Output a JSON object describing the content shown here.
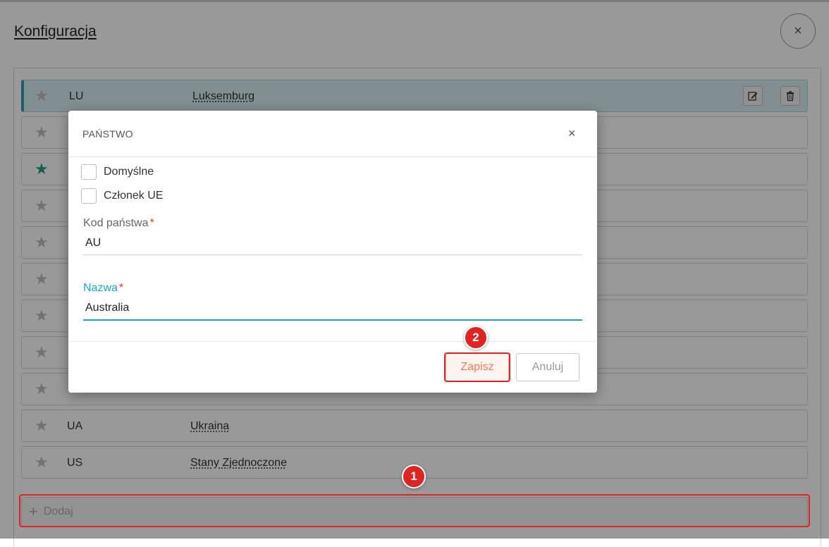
{
  "page": {
    "title": "Konfiguracja",
    "close_symbol": "×"
  },
  "countries": [
    {
      "code": "LU",
      "name": "Luksemburg",
      "favorite": false,
      "active": true
    },
    {
      "code": "",
      "name": "",
      "favorite": false,
      "active": false
    },
    {
      "code": "",
      "name": "",
      "favorite": true,
      "active": false
    },
    {
      "code": "",
      "name": "",
      "favorite": false,
      "active": false
    },
    {
      "code": "",
      "name": "",
      "favorite": false,
      "active": false
    },
    {
      "code": "",
      "name": "",
      "favorite": false,
      "active": false
    },
    {
      "code": "",
      "name": "",
      "favorite": false,
      "active": false
    },
    {
      "code": "",
      "name": "",
      "favorite": false,
      "active": false
    },
    {
      "code": "",
      "name": "",
      "favorite": false,
      "active": false
    },
    {
      "code": "UA",
      "name": "Ukraina",
      "favorite": false,
      "active": false
    },
    {
      "code": "US",
      "name": "Stany Zjednoczone",
      "favorite": false,
      "active": false
    }
  ],
  "add_bar": {
    "label": "Dodaj",
    "icon": "plus-icon"
  },
  "dialog": {
    "title": "PAŃSTWO",
    "close_symbol": "×",
    "checkboxes": {
      "default_label": "Domyślne",
      "eu_member_label": "Członek UE"
    },
    "code_field": {
      "label": "Kod państwa",
      "value": "AU",
      "required_mark": "*"
    },
    "name_field": {
      "label": "Nazwa",
      "value": "Australia",
      "required_mark": "*"
    },
    "save_label": "Zapisz",
    "cancel_label": "Anuluj"
  },
  "annotations": {
    "badge_1": "1",
    "badge_2": "2"
  },
  "colors": {
    "accent": "#1aa8c1",
    "favorite_star": "#1e9e84",
    "save_text": "#f27c4e",
    "highlight": "#e02424"
  }
}
